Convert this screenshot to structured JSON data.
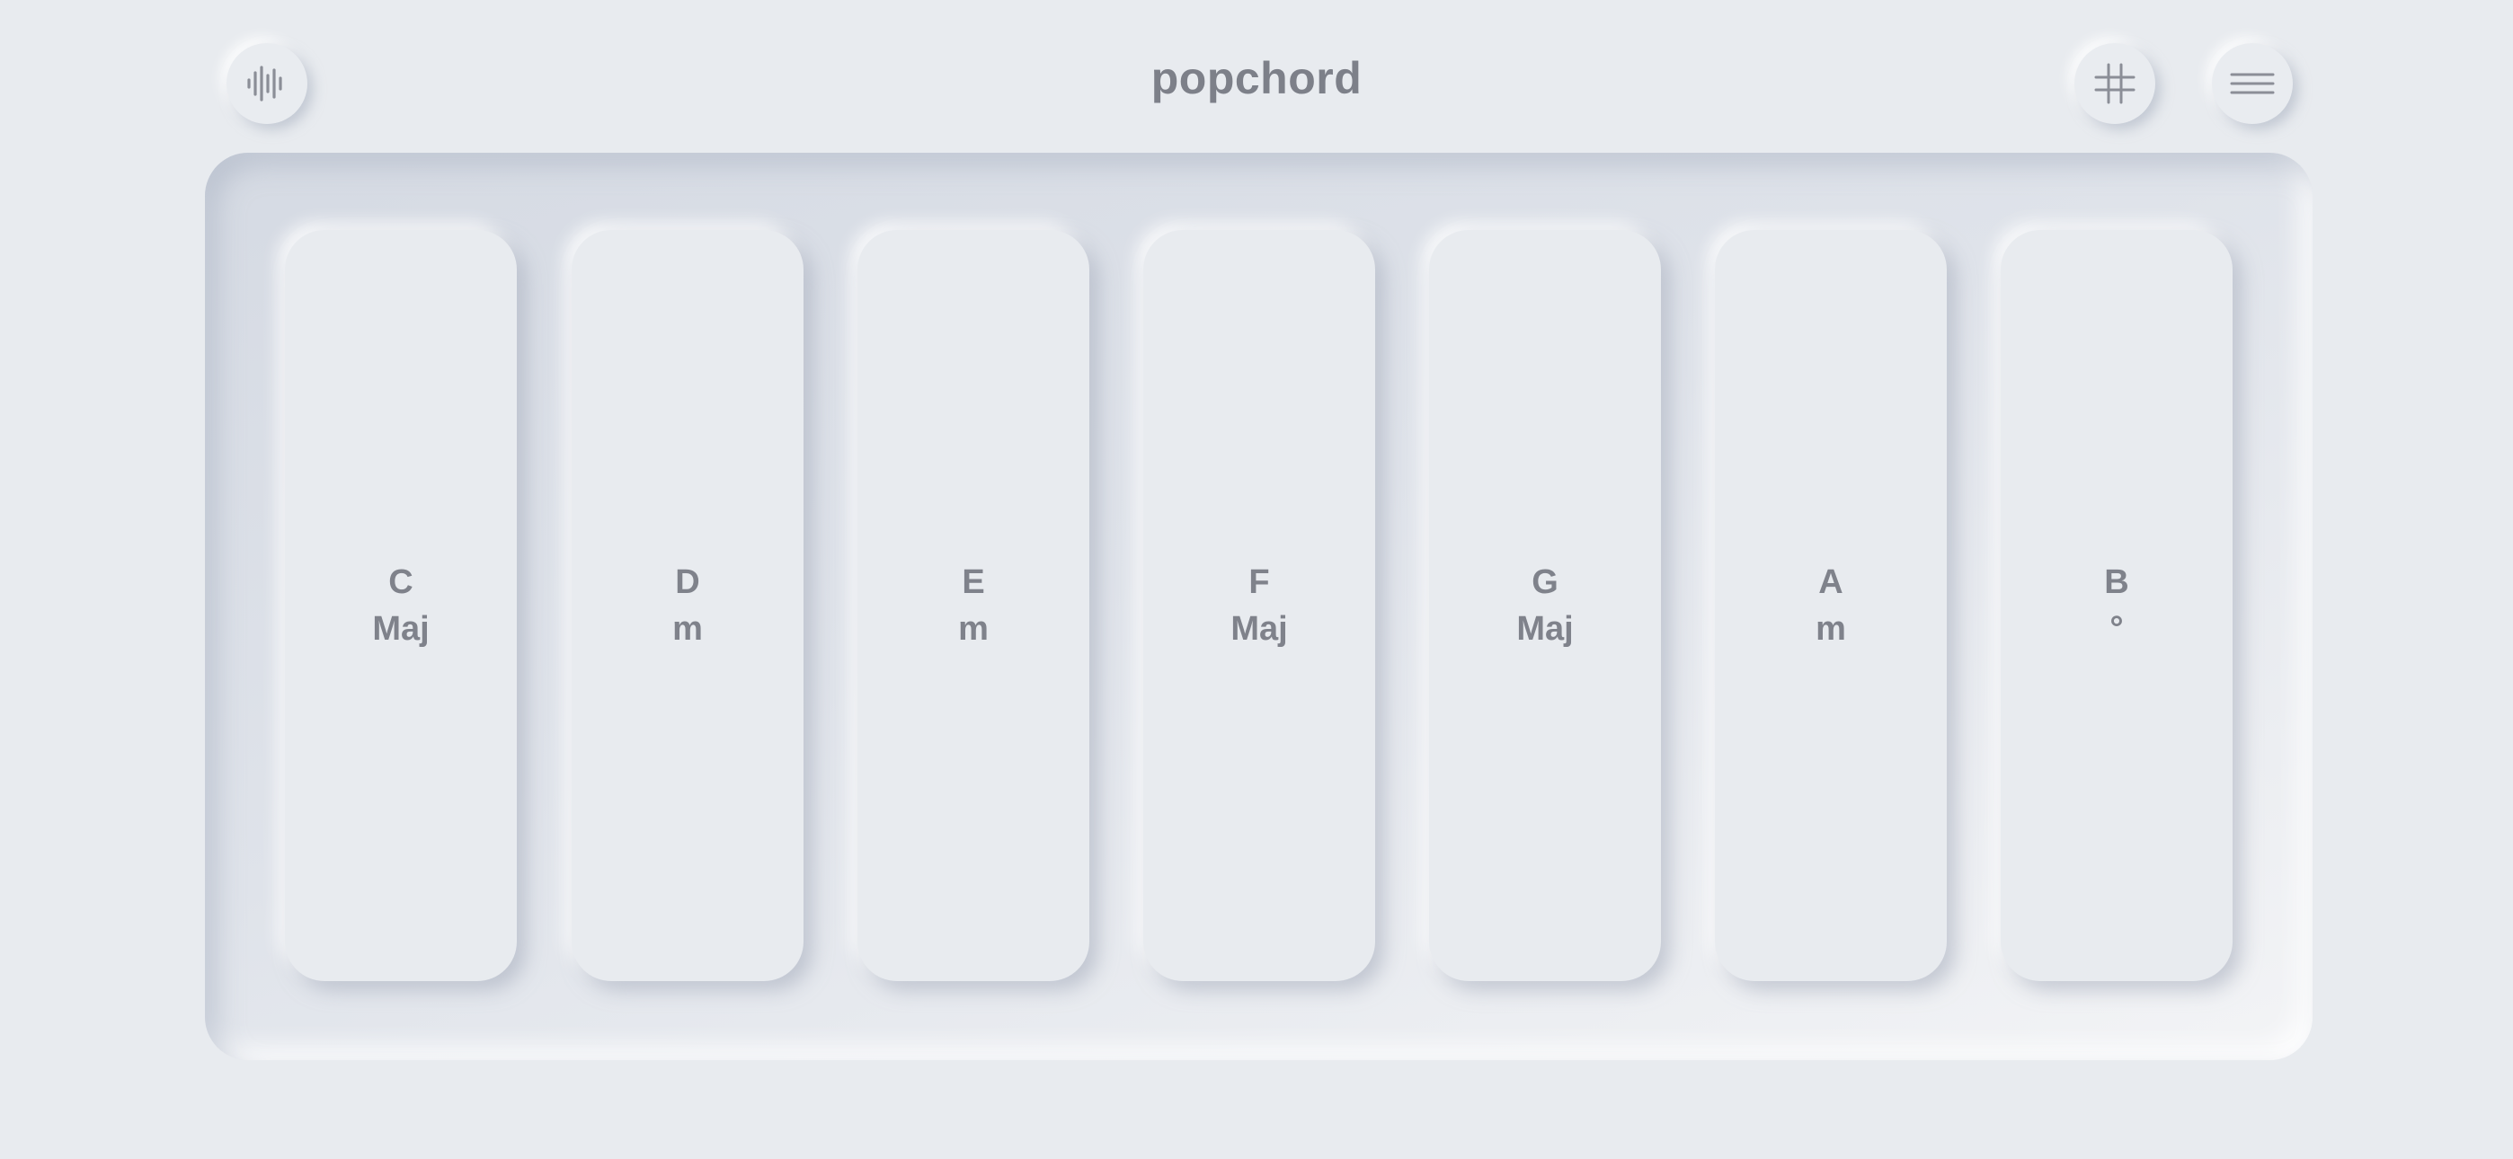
{
  "app": {
    "title": "popchord"
  },
  "toolbar": {
    "left_icon": "waveform-icon",
    "right_icons": [
      "grid-icon",
      "menu-icon"
    ]
  },
  "colors": {
    "background": "#e8ebef",
    "text": "#7d8089",
    "tray_shadow": "#d5dae3"
  },
  "chords": [
    {
      "root": "C",
      "quality": "Maj"
    },
    {
      "root": "D",
      "quality": "m"
    },
    {
      "root": "E",
      "quality": "m"
    },
    {
      "root": "F",
      "quality": "Maj"
    },
    {
      "root": "G",
      "quality": "Maj"
    },
    {
      "root": "A",
      "quality": "m"
    },
    {
      "root": "B",
      "quality": "°"
    }
  ]
}
